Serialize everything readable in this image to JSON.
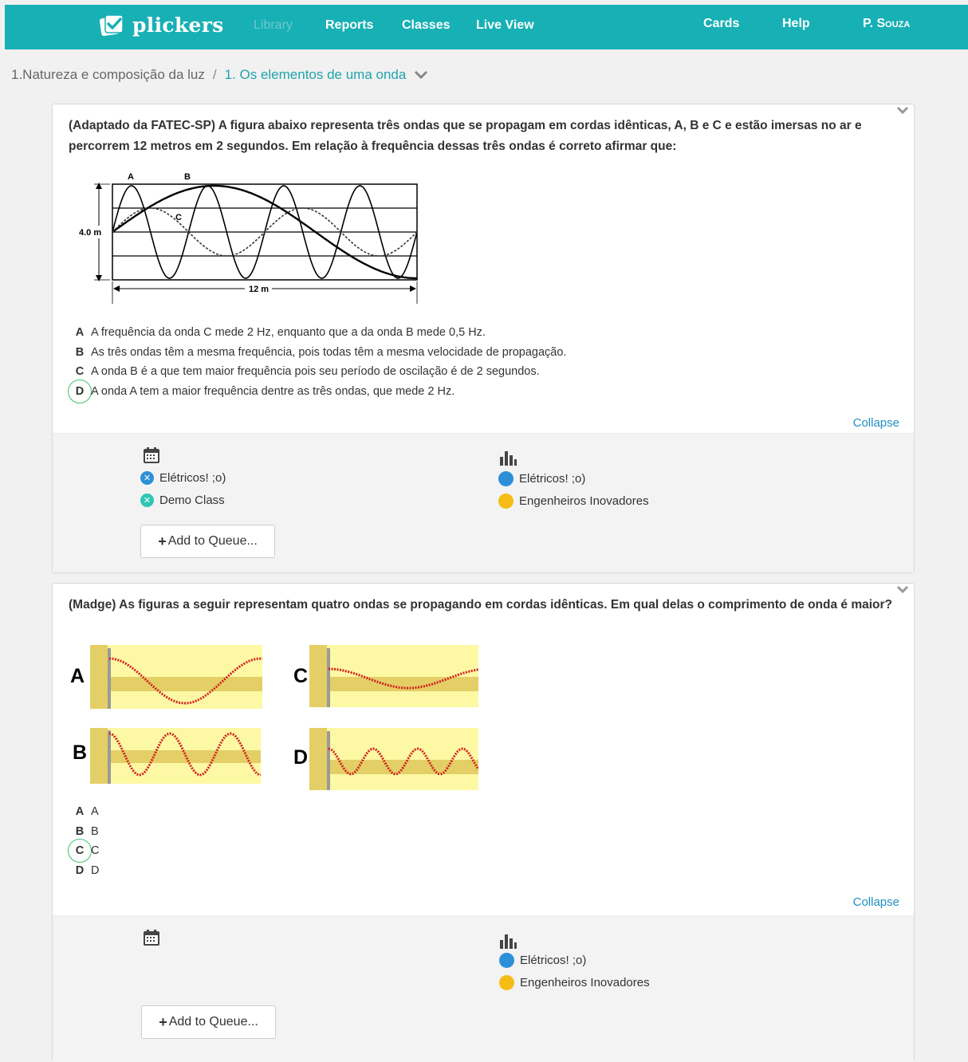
{
  "nav": {
    "logo": "plickers",
    "links": {
      "library": "Library",
      "reports": "Reports",
      "classes": "Classes",
      "live_view": "Live View"
    },
    "right": {
      "cards": "Cards",
      "help": "Help",
      "user": "P. Souza"
    }
  },
  "breadcrumb": {
    "parent": "1.Natureza e composição da luz",
    "separator": "/",
    "current": "1. Os elementos de uma onda"
  },
  "questions": [
    {
      "text": "(Adaptado da FATEC-SP) A figura abaixo representa três ondas que se propagam em cordas idênticas, A, B e C e estão imersas no ar e percorrem 12 metros em 2 segundos. Em relação à frequência dessas três ondas é correto afirmar que:",
      "figure": {
        "label_a": "A",
        "label_b": "B",
        "label_c": "C",
        "height_label": "4.0 m",
        "width_label": "12 m"
      },
      "choices": [
        {
          "letter": "A",
          "text": "A frequência da onda C mede 2 Hz, enquanto que a da onda B mede 0,5 Hz.",
          "correct": false
        },
        {
          "letter": "B",
          "text": "As três ondas têm a mesma frequência, pois todas têm a mesma velocidade de propagação.",
          "correct": false
        },
        {
          "letter": "C",
          "text": "A onda B é a que tem maior frequência pois seu período de oscilação é de 2 segundos.",
          "correct": false
        },
        {
          "letter": "D",
          "text": "A onda A tem a maior frequência dentre as três ondas, que mede 2 Hz.",
          "correct": true
        }
      ],
      "collapse": "Collapse",
      "scheduled": [
        {
          "name": "Elétricos! ;o)",
          "color": "#2d8fd8"
        },
        {
          "name": "Demo Class",
          "color": "#2fc6b5"
        }
      ],
      "reports": [
        {
          "name": "Elétricos! ;o)",
          "color": "#2d8fd8"
        },
        {
          "name": "Engenheiros Inovadores",
          "color": "#f5bc16"
        }
      ],
      "queue_button": "Add to Queue..."
    },
    {
      "text": "(Madge) As figuras a seguir representam quatro ondas se propagando em cordas idênticas. Em qual delas o comprimento de onda é maior?",
      "figure": {
        "labels": [
          "A",
          "C",
          "B",
          "D"
        ]
      },
      "choices": [
        {
          "letter": "A",
          "text": "A",
          "correct": false
        },
        {
          "letter": "B",
          "text": "B",
          "correct": false
        },
        {
          "letter": "C",
          "text": "C",
          "correct": true
        },
        {
          "letter": "D",
          "text": "D",
          "correct": false
        }
      ],
      "collapse": "Collapse",
      "reports": [
        {
          "name": "Elétricos! ;o)",
          "color": "#2d8fd8"
        },
        {
          "name": "Engenheiros Inovadores",
          "color": "#f5bc16"
        }
      ],
      "queue_button": "Add to Queue..."
    }
  ]
}
